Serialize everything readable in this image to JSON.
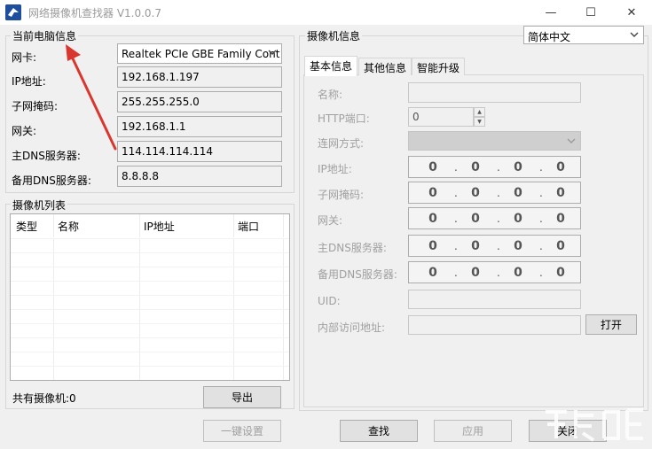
{
  "window": {
    "title": "网络摄像机查找器 V1.0.0.7",
    "minimize_glyph": "—",
    "maximize_glyph": "☐",
    "close_glyph": "✕"
  },
  "left": {
    "group_title": "当前电脑信息",
    "nic_label": "网卡:",
    "nic_value": "Realtek PCIe GBE Family Cont",
    "ip_label": "IP地址:",
    "ip_value": "192.168.1.197",
    "mask_label": "子网掩码:",
    "mask_value": "255.255.255.0",
    "gateway_label": "网关:",
    "gateway_value": "192.168.1.1",
    "dns1_label": "主DNS服务器:",
    "dns1_value": "114.114.114.114",
    "dns2_label": "备用DNS服务器:",
    "dns2_value": "8.8.8.8"
  },
  "list": {
    "group_title": "摄像机列表",
    "columns": [
      "类型",
      "名称",
      "IP地址",
      "端口"
    ],
    "count_text": "共有摄像机:0",
    "export_label": "导出"
  },
  "right": {
    "group_title": "摄像机信息",
    "language_value": "简体中文",
    "tabs": [
      "基本信息",
      "其他信息",
      "智能升级"
    ],
    "name_label": "名称:",
    "http_port_label": "HTTP端口:",
    "http_port_value": "0",
    "net_mode_label": "连网方式:",
    "ip_label": "IP地址:",
    "mask_label": "子网掩码:",
    "gateway_label": "网关:",
    "dns1_label": "主DNS服务器:",
    "dns2_label": "备用DNS服务器:",
    "ip_octet": "0",
    "ip_dot": ".",
    "uid_label": "UID:",
    "internal_url_label": "内部访问地址:",
    "open_label": "打开"
  },
  "footer": {
    "one_click_label": "一键设置",
    "search_label": "查找",
    "apply_label": "应用",
    "close_label": "关闭"
  },
  "colors": {
    "annotation_arrow": "#d9362e",
    "title_text": "#9a9a9a",
    "disabled_text": "#a0a0a0"
  },
  "icons": {
    "app": "camera-finder-icon",
    "dropdown": "chevron-down-icon",
    "spinner_up": "triangle-up-icon",
    "spinner_down": "triangle-down-icon"
  }
}
